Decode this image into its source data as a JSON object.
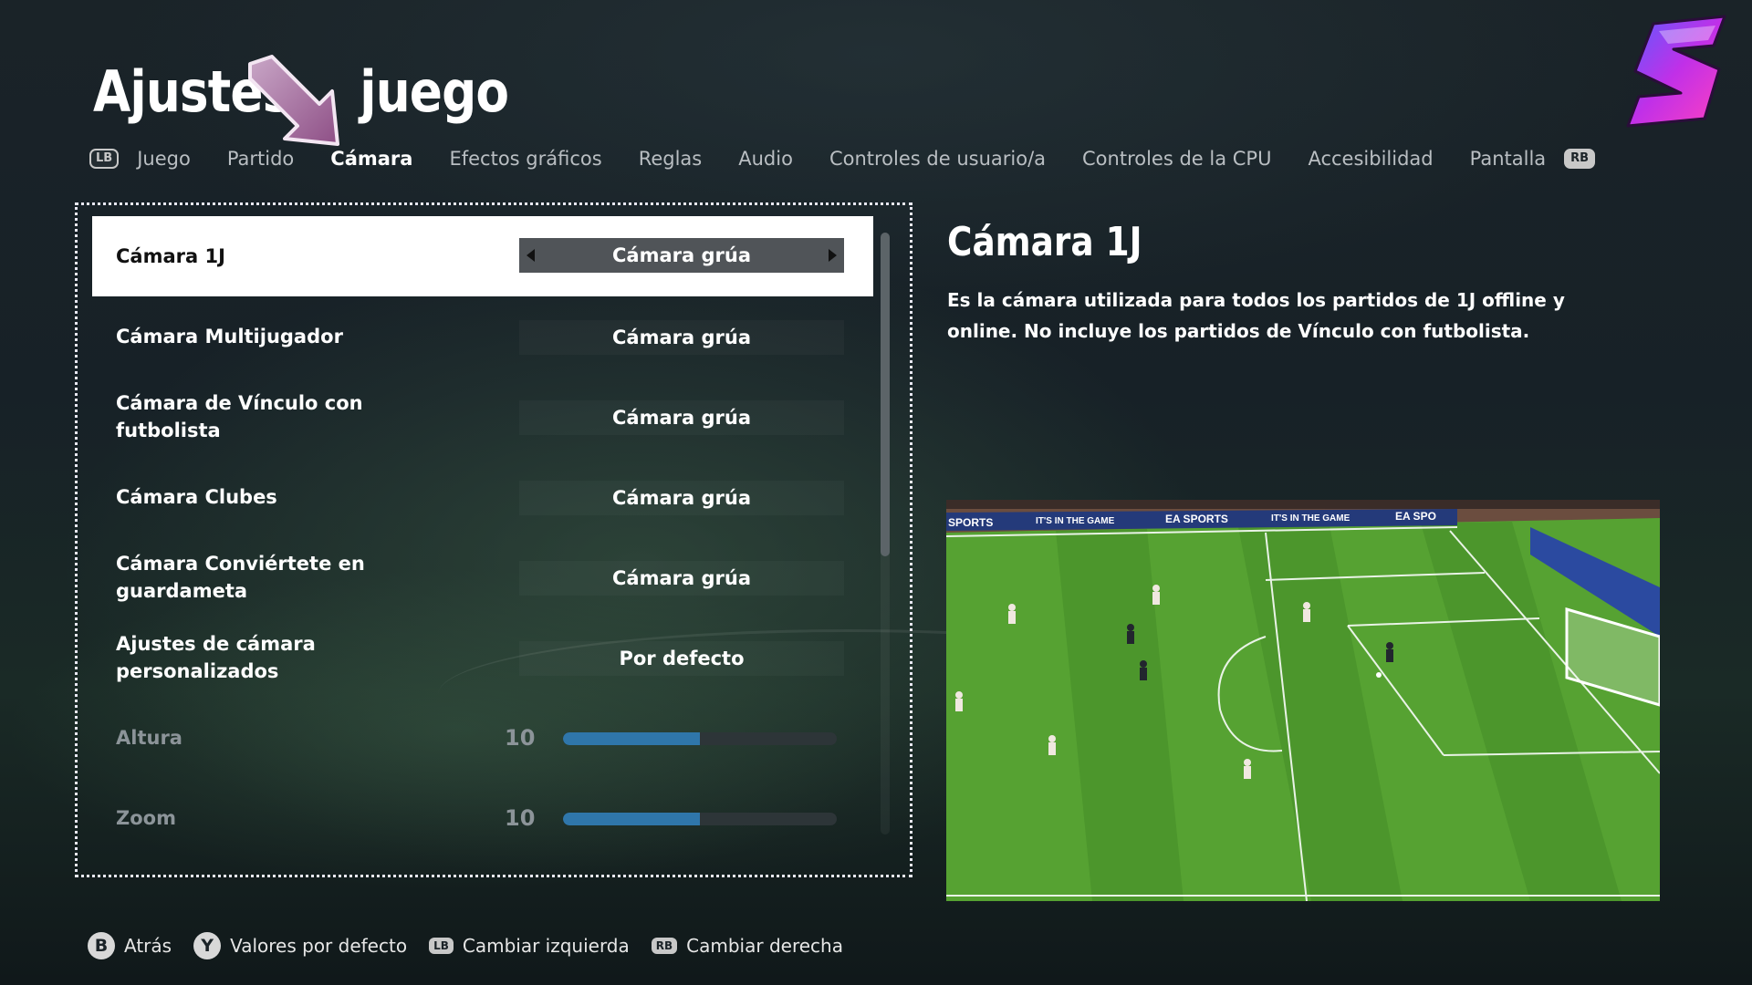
{
  "header": {
    "title": "Ajustes de juego",
    "title_visible_left": "Ajustes",
    "title_visible_right": "juego"
  },
  "tabs": {
    "left_bumper": "LB",
    "right_bumper": "RB",
    "items": [
      {
        "label": "Juego",
        "active": false
      },
      {
        "label": "Partido",
        "active": false
      },
      {
        "label": "Cámara",
        "active": true
      },
      {
        "label": "Efectos gráficos",
        "active": false
      },
      {
        "label": "Reglas",
        "active": false
      },
      {
        "label": "Audio",
        "active": false
      },
      {
        "label": "Controles de usuario/a",
        "active": false
      },
      {
        "label": "Controles de la CPU",
        "active": false
      },
      {
        "label": "Accesibilidad",
        "active": false
      },
      {
        "label": "Pantalla",
        "active": false
      }
    ]
  },
  "settings": {
    "rows": [
      {
        "label": "Cámara 1J",
        "value": "Cámara grúa"
      },
      {
        "label": "Cámara Multijugador",
        "value": "Cámara grúa"
      },
      {
        "label": "Cámara de Vínculo con futbolista",
        "value": "Cámara grúa"
      },
      {
        "label": "Cámara Clubes",
        "value": "Cámara grúa"
      },
      {
        "label": "Cámara Conviértete en guardameta",
        "value": "Cámara grúa"
      },
      {
        "label": "Ajustes de cámara personalizados",
        "value": "Por defecto"
      }
    ],
    "sliders": [
      {
        "label": "Altura",
        "value": "10",
        "fill_fraction": 0.5
      },
      {
        "label": "Zoom",
        "value": "10",
        "fill_fraction": 0.5
      }
    ]
  },
  "info": {
    "title": "Cámara 1J",
    "description": "Es la cámara utilizada para todos los partidos de 1J offline y online. No incluye los partidos de Vínculo con futbolista."
  },
  "preview": {
    "ad_boards": [
      "SPORTS",
      "IT'S IN THE GAME",
      "EA SPORTS",
      "IT'S IN THE GAME",
      "EA SPO"
    ]
  },
  "footer": {
    "back": {
      "button": "B",
      "label": "Atrás"
    },
    "defaults": {
      "button": "Y",
      "label": "Valores por defecto"
    },
    "switch_left": {
      "button": "LB",
      "label": "Cambiar izquierda"
    },
    "switch_right": {
      "button": "RB",
      "label": "Cambiar derecha"
    }
  },
  "colors": {
    "slider_fill": "#2f76aa",
    "pitch_green": "#4f9a2e",
    "accent_logo": "#b030e0"
  }
}
